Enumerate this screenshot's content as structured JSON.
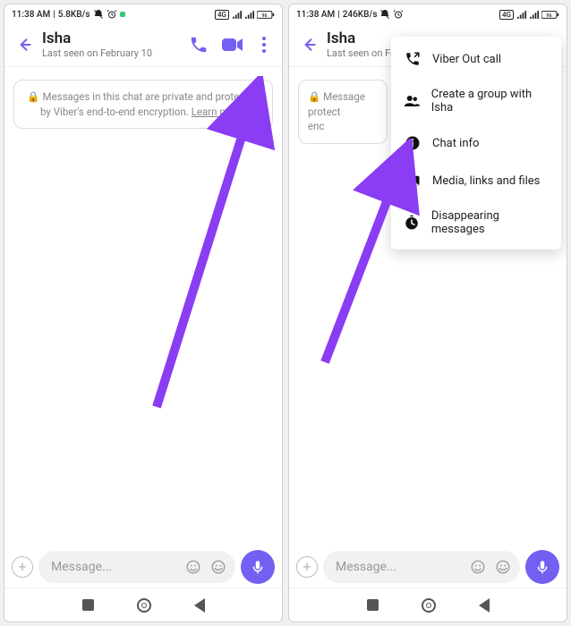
{
  "left": {
    "status": {
      "time": "11:38 AM",
      "speed": "5.8KB/s"
    },
    "contact": {
      "name": "Isha",
      "sub": "Last seen on February 10"
    },
    "privacy": {
      "text": "Messages in this chat are private and protected by Viber's end-to-end encryption.",
      "learn_more": "Learn more"
    },
    "composer": {
      "placeholder": "Message..."
    }
  },
  "right": {
    "status": {
      "time": "11:38 AM",
      "speed": "246KB/s"
    },
    "contact": {
      "name": "Isha",
      "sub": "Last seen on Fe"
    },
    "privacy": {
      "l1": "Message",
      "l2": "protect",
      "l3": "enc"
    },
    "composer": {
      "placeholder": "Message..."
    },
    "menu": {
      "viber_out": "Viber Out call",
      "create_group": "Create a group with Isha",
      "chat_info": "Chat info",
      "media": "Media, links and files",
      "disappearing": "Disappearing messages"
    }
  },
  "colors": {
    "accent": "#7360f2"
  }
}
